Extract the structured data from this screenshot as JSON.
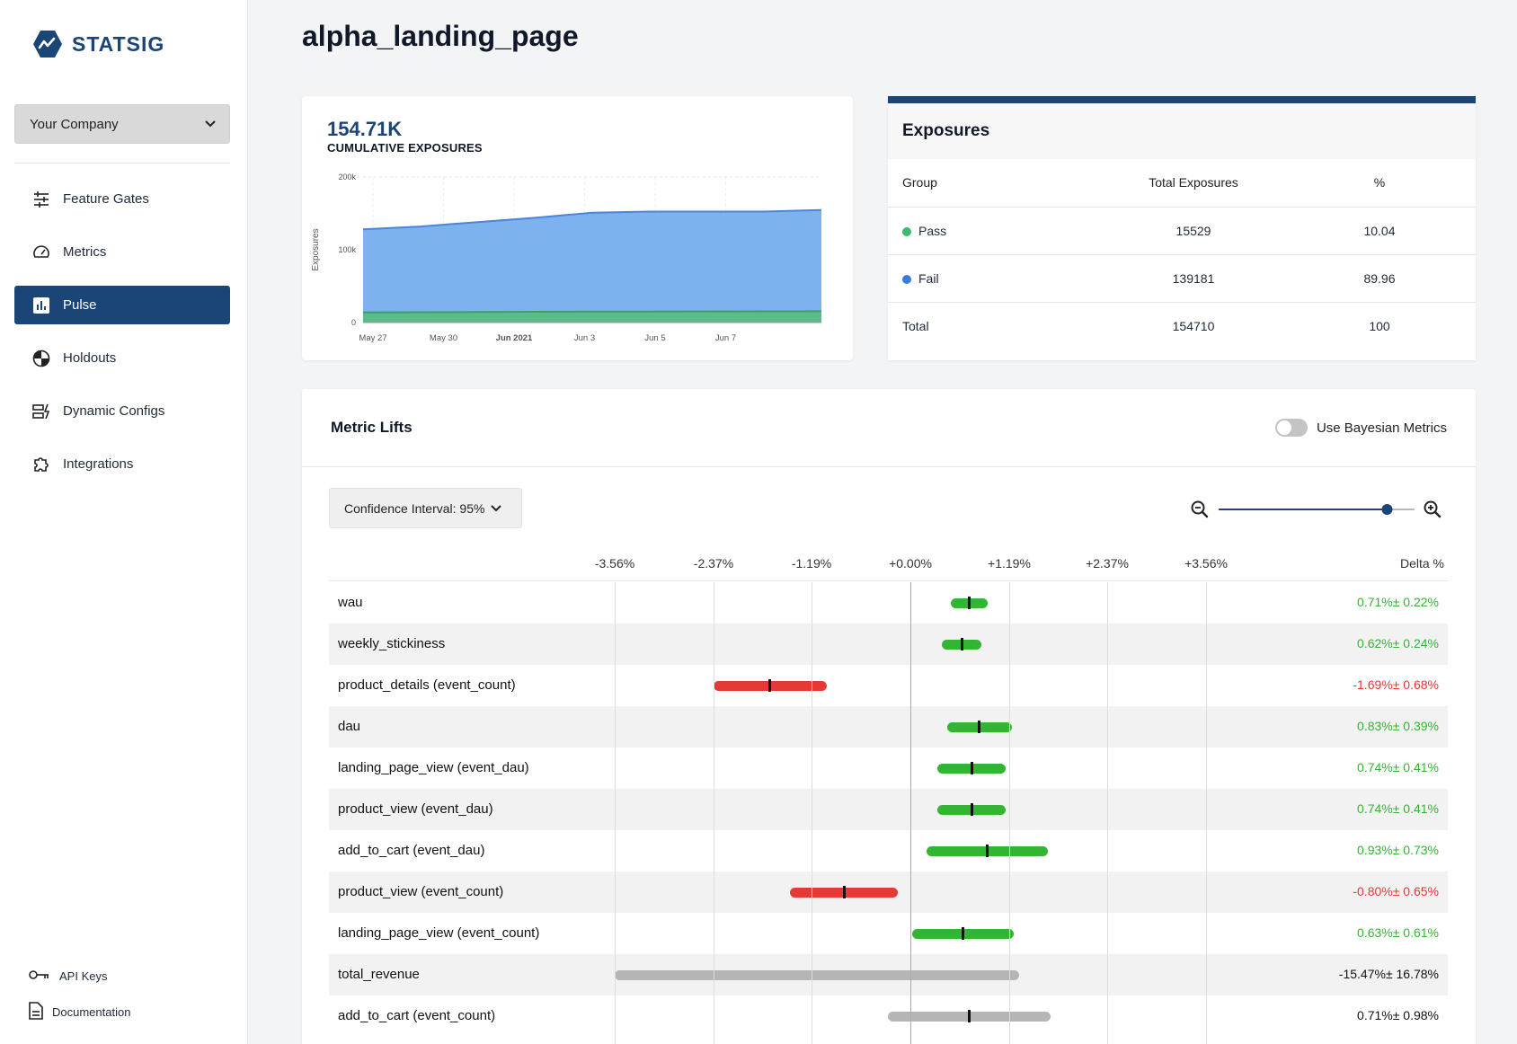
{
  "brand": {
    "name": "STATSIG",
    "color": "#1c4577"
  },
  "sidebar": {
    "company": "Your Company",
    "items": [
      {
        "label": "Feature Gates",
        "icon": "sliders-icon",
        "active": false
      },
      {
        "label": "Metrics",
        "icon": "gauge-icon",
        "active": false
      },
      {
        "label": "Pulse",
        "icon": "bar-chart-icon",
        "active": true
      },
      {
        "label": "Holdouts",
        "icon": "holdout-icon",
        "active": false
      },
      {
        "label": "Dynamic Configs",
        "icon": "config-icon",
        "active": false
      },
      {
        "label": "Integrations",
        "icon": "puzzle-icon",
        "active": false
      }
    ],
    "bottom": [
      {
        "label": "API Keys",
        "icon": "key-icon"
      },
      {
        "label": "Documentation",
        "icon": "document-icon"
      }
    ]
  },
  "page": {
    "title": "alpha_landing_page"
  },
  "exposure_summary": {
    "value": "154.71K",
    "label": "CUMULATIVE EXPOSURES"
  },
  "chart_data": {
    "type": "area",
    "ylabel": "Exposures",
    "y_ticks": [
      "200k",
      "100k",
      "0"
    ],
    "ylim": [
      0,
      200000
    ],
    "x_ticks": [
      "May 27",
      "May 30",
      "Jun 2021",
      "Jun 3",
      "Jun 5",
      "Jun 7"
    ],
    "series": [
      {
        "color": "#7eb2ee",
        "line": "#4a86d8",
        "values": [
          128000,
          132000,
          138000,
          144000,
          151000,
          152500,
          152500,
          152500,
          154710
        ]
      },
      {
        "color": "#5dbb8a",
        "line": "#3aa06a",
        "values": [
          14000,
          14200,
          14500,
          14800,
          15100,
          15200,
          15300,
          15400,
          15529
        ]
      }
    ]
  },
  "exposures": {
    "title": "Exposures",
    "columns": [
      "Group",
      "Total Exposures",
      "%"
    ],
    "rows": [
      {
        "group": "Pass",
        "dot": "#3cba6e",
        "total": "15529",
        "pct": "10.04"
      },
      {
        "group": "Fail",
        "dot": "#3a7be0",
        "total": "139181",
        "pct": "89.96"
      },
      {
        "group": "Total",
        "dot": "",
        "total": "154710",
        "pct": "100"
      }
    ]
  },
  "metric_lifts": {
    "title": "Metric Lifts",
    "bayesian_label": "Use Bayesian Metrics",
    "bayesian_enabled": false,
    "confidence": "Confidence Interval: 95%",
    "zoom_level": 0.86,
    "delta_header": "Delta %",
    "ticks": [
      "-3.56%",
      "-2.37%",
      "-1.19%",
      "+0.00%",
      "+1.19%",
      "+2.37%",
      "+3.56%"
    ],
    "tick_values": [
      -3.56,
      -2.37,
      -1.19,
      0,
      1.19,
      2.37,
      3.56
    ],
    "colors": {
      "positive": "#33b533",
      "negative": "#e53935",
      "neutral": "#b5b5b5"
    },
    "rows": [
      {
        "name": "wau",
        "mean": 0.71,
        "ci": 0.22,
        "status": "positive",
        "delta": "0.71%± 0.22%"
      },
      {
        "name": "weekly_stickiness",
        "mean": 0.62,
        "ci": 0.24,
        "status": "positive",
        "delta": "0.62%± 0.24%"
      },
      {
        "name": "product_details (event_count)",
        "mean": -1.69,
        "ci": 0.68,
        "status": "negative",
        "delta": "-1.69%± 0.68%"
      },
      {
        "name": "dau",
        "mean": 0.83,
        "ci": 0.39,
        "status": "positive",
        "delta": "0.83%± 0.39%"
      },
      {
        "name": "landing_page_view (event_dau)",
        "mean": 0.74,
        "ci": 0.41,
        "status": "positive",
        "delta": "0.74%± 0.41%"
      },
      {
        "name": "product_view (event_dau)",
        "mean": 0.74,
        "ci": 0.41,
        "status": "positive",
        "delta": "0.74%± 0.41%"
      },
      {
        "name": "add_to_cart (event_dau)",
        "mean": 0.93,
        "ci": 0.73,
        "status": "positive",
        "delta": "0.93%± 0.73%"
      },
      {
        "name": "product_view (event_count)",
        "mean": -0.8,
        "ci": 0.65,
        "status": "negative",
        "delta": "-0.80%± 0.65%"
      },
      {
        "name": "landing_page_view (event_count)",
        "mean": 0.63,
        "ci": 0.61,
        "status": "positive",
        "delta": "0.63%± 0.61%"
      },
      {
        "name": "total_revenue",
        "mean": -15.47,
        "ci": 16.78,
        "status": "neutral",
        "delta": "-15.47%± 16.78%"
      },
      {
        "name": "add_to_cart (event_count)",
        "mean": 0.71,
        "ci": 0.98,
        "status": "neutral",
        "delta": "0.71%± 0.98%"
      }
    ]
  }
}
